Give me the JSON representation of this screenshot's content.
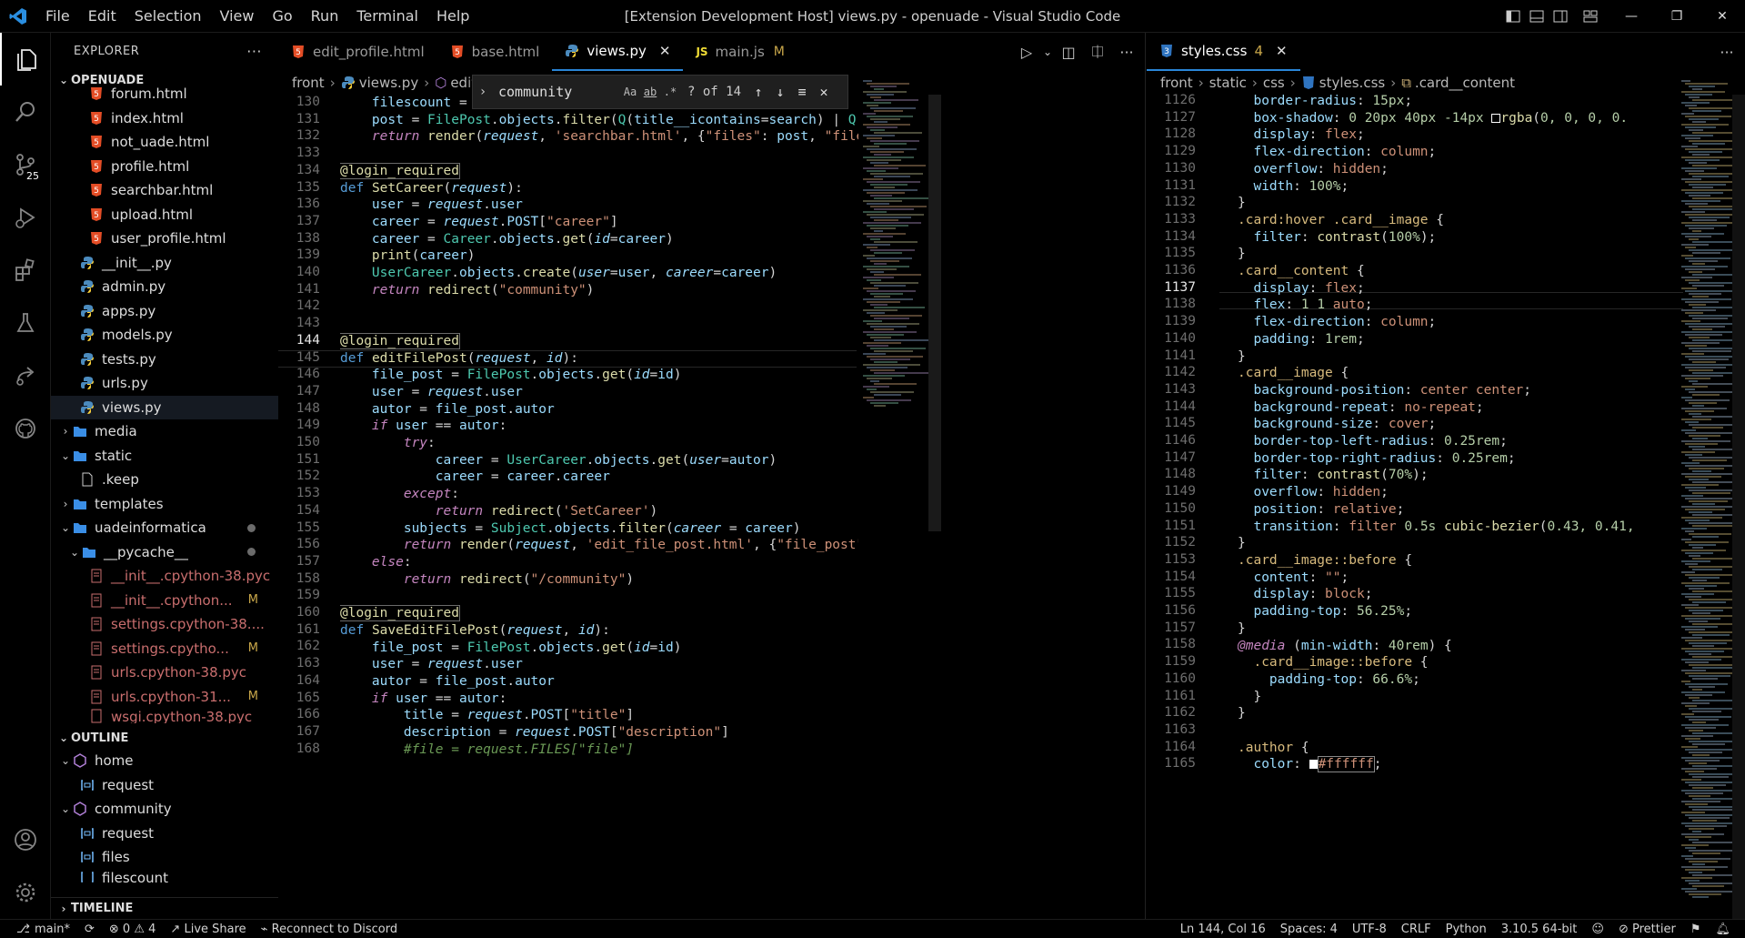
{
  "window": {
    "title": "[Extension Development Host] views.py - openuade - Visual Studio Code",
    "controls": [
      "—",
      "❐",
      "✕"
    ]
  },
  "menu": [
    "File",
    "Edit",
    "Selection",
    "View",
    "Go",
    "Run",
    "Terminal",
    "Help"
  ],
  "activity": {
    "icons": [
      "explorer-icon",
      "search-icon",
      "source-control-icon",
      "run-debug-icon",
      "extensions-icon",
      "testing-icon",
      "live-share-icon",
      "github-icon"
    ],
    "scm_badge": "25",
    "bottom_icons": [
      "account-icon",
      "settings-gear-icon"
    ]
  },
  "sidebar": {
    "title": "EXPLORER",
    "more": "···",
    "root": "OPENUADE",
    "files": [
      {
        "name": "forum.html",
        "type": "html"
      },
      {
        "name": "index.html",
        "type": "html"
      },
      {
        "name": "not_uade.html",
        "type": "html"
      },
      {
        "name": "profile.html",
        "type": "html"
      },
      {
        "name": "searchbar.html",
        "type": "html"
      },
      {
        "name": "upload.html",
        "type": "html"
      },
      {
        "name": "user_profile.html",
        "type": "html"
      },
      {
        "name": "__init__.py",
        "type": "py"
      },
      {
        "name": "admin.py",
        "type": "py"
      },
      {
        "name": "apps.py",
        "type": "py"
      },
      {
        "name": "models.py",
        "type": "py"
      },
      {
        "name": "tests.py",
        "type": "py"
      },
      {
        "name": "urls.py",
        "type": "py"
      },
      {
        "name": "views.py",
        "type": "py"
      }
    ],
    "folders": [
      {
        "name": "media"
      },
      {
        "name": "static"
      },
      {
        "name": ".keep"
      },
      {
        "name": "templates"
      },
      {
        "name": "uadeinformatica"
      },
      {
        "name": "__pycache__"
      }
    ],
    "pycache": [
      {
        "name": "__init__.cpython-38.pyc",
        "mod": ""
      },
      {
        "name": "__init__.cpython...",
        "mod": "M"
      },
      {
        "name": "settings.cpython-38....",
        "mod": ""
      },
      {
        "name": "settings.cpytho...",
        "mod": "M"
      },
      {
        "name": "urls.cpython-38.pyc",
        "mod": ""
      },
      {
        "name": "urls.cpython-31...",
        "mod": "M"
      },
      {
        "name": "wsgi.cpython-38.pyc",
        "mod": ""
      }
    ],
    "outline_title": "OUTLINE",
    "outline": [
      {
        "name": "home",
        "level": 1,
        "kind": "function"
      },
      {
        "name": "request",
        "level": 2,
        "kind": "variable"
      },
      {
        "name": "community",
        "level": 1,
        "kind": "function"
      },
      {
        "name": "request",
        "level": 2,
        "kind": "variable"
      },
      {
        "name": "files",
        "level": 2,
        "kind": "variable"
      },
      {
        "name": "filescount",
        "level": 2,
        "kind": "variable"
      }
    ],
    "timeline_title": "TIMELINE"
  },
  "editor_left": {
    "tabs": [
      {
        "label": "edit_profile.html",
        "type": "html",
        "active": false,
        "mod": ""
      },
      {
        "label": "base.html",
        "type": "html",
        "active": false,
        "mod": ""
      },
      {
        "label": "views.py",
        "type": "py",
        "active": true,
        "mod": ""
      },
      {
        "label": "main.js",
        "type": "js",
        "active": false,
        "mod": "M"
      }
    ],
    "close": "✕",
    "breadcrumb": [
      "front",
      "views.py",
      "editFilePost"
    ],
    "find": {
      "query": "community",
      "count": "? of 14",
      "opt_case": "Aa",
      "opt_word": "ab",
      "opt_regex": ".*"
    },
    "current_line": "144"
  },
  "editor_right": {
    "tab": {
      "label": "styles.css",
      "badge": "4"
    },
    "breadcrumb": [
      "front",
      "static",
      "css",
      "styles.css",
      ".card__content"
    ],
    "current_line": "1137"
  },
  "statusbar": {
    "branch": "main*",
    "errors": "0",
    "warnings": "4",
    "liveshare": "Live Share",
    "discord": "Reconnect to Discord",
    "position": "Ln 144, Col 16",
    "spaces": "Spaces: 4",
    "encoding": "UTF-8",
    "eol": "CRLF",
    "language": "Python",
    "interpreter": "3.10.5 64-bit",
    "prettier": "Prettier"
  },
  "colors": {
    "accent": "#2a86d8",
    "html_icon": "#e44d26",
    "python_icon": "#4b8bbe",
    "css_icon": "#2f74c0",
    "modified": "#c9a74a"
  }
}
